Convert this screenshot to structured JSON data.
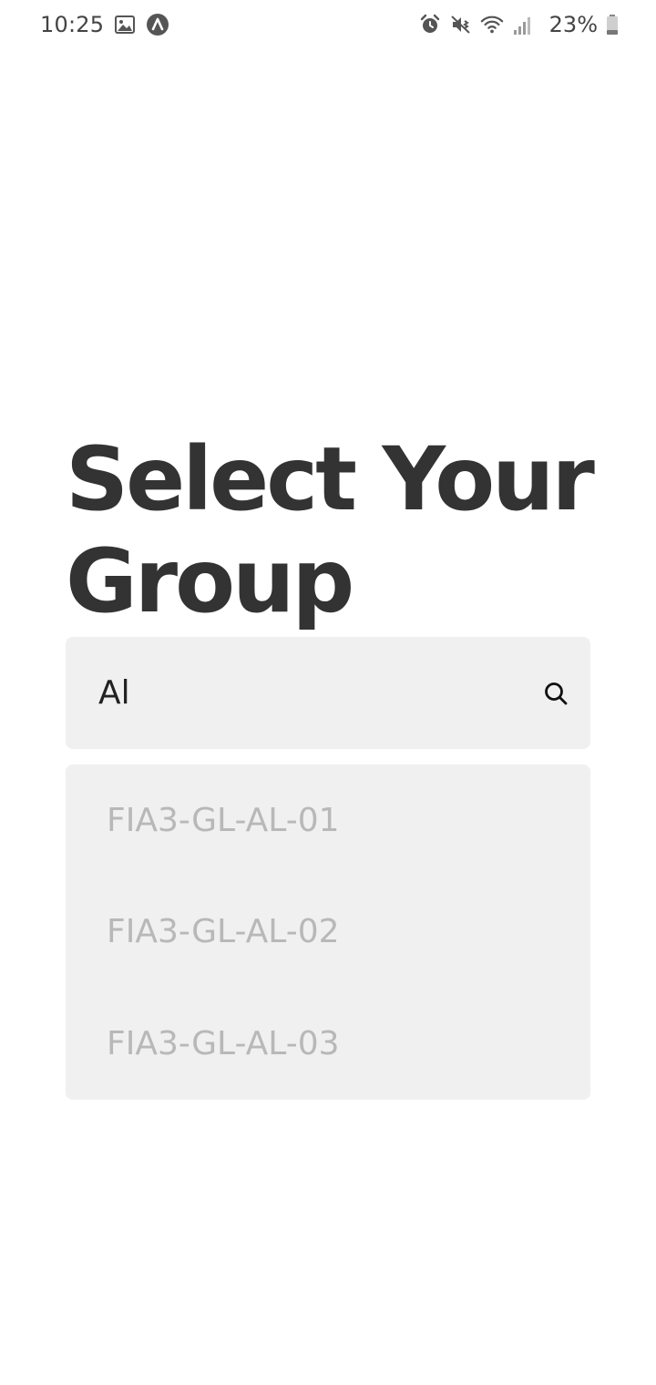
{
  "status_bar": {
    "time": "10:25",
    "battery_percent": "23%",
    "left_icons": [
      "gallery-icon",
      "app-notification-icon"
    ],
    "right_icons": [
      "alarm-icon",
      "vibrate-mute-icon",
      "wifi-icon",
      "signal-icon",
      "battery-icon"
    ]
  },
  "page": {
    "title": "Select Your Group"
  },
  "search": {
    "value": "Al",
    "icon": "search-icon"
  },
  "suggestions": [
    {
      "label": "FIA3-GL-AL-01"
    },
    {
      "label": "FIA3-GL-AL-02"
    },
    {
      "label": "FIA3-GL-AL-03"
    }
  ],
  "colors": {
    "title": "#333333",
    "field_background": "#f0f0f0",
    "suggestion_text": "#b8b8b8",
    "input_text": "#222222"
  }
}
